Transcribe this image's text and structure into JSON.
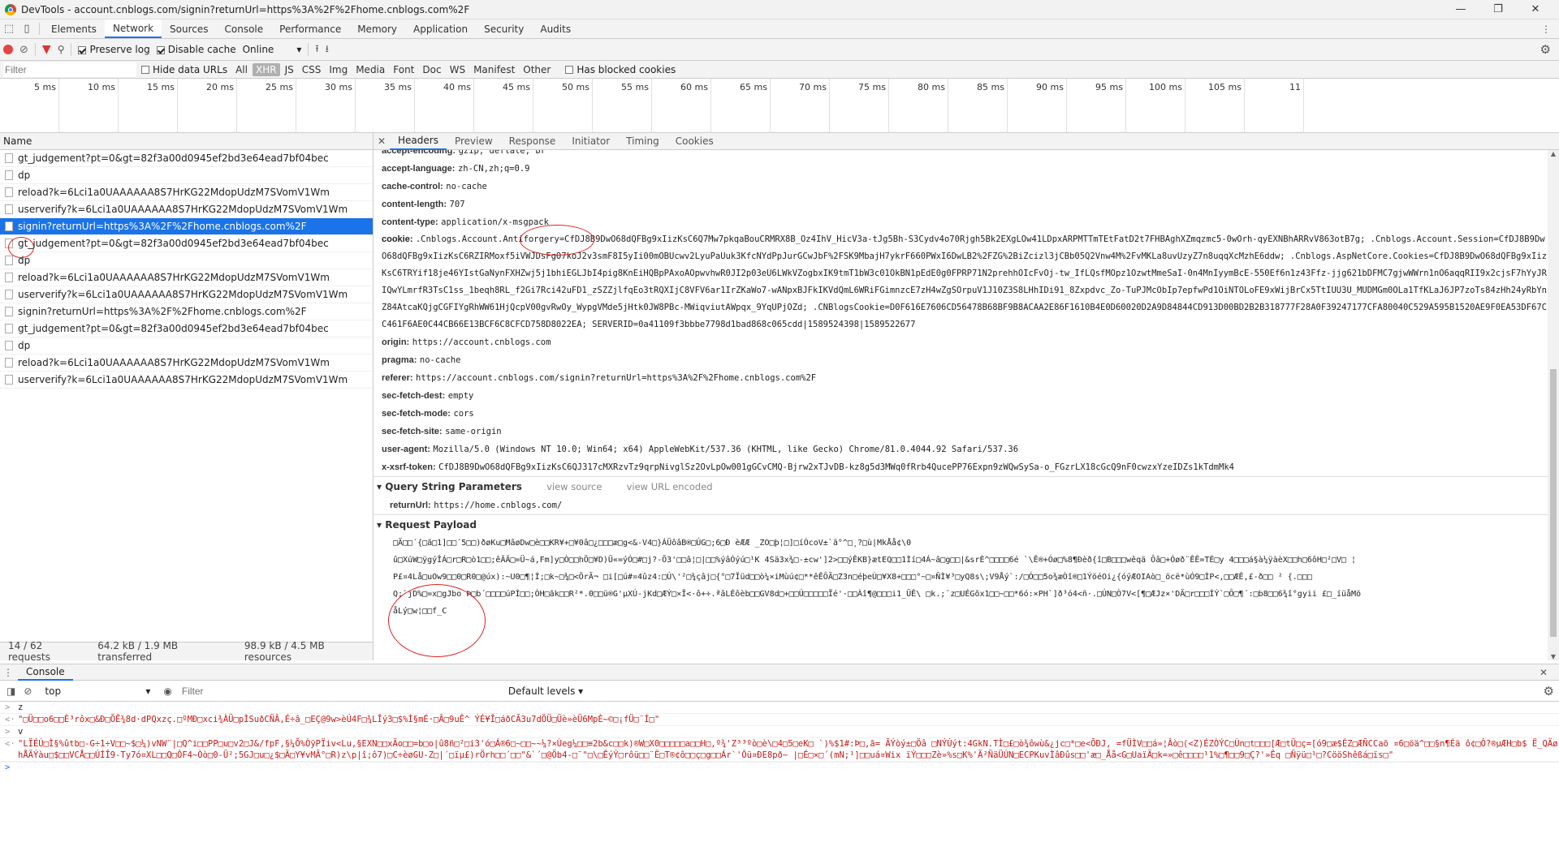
{
  "window": {
    "title": "DevTools - account.cnblogs.com/signin?returnUrl=https%3A%2F%2Fhome.cnblogs.com%2F",
    "minimize": "—",
    "restore": "❐",
    "close": "✕"
  },
  "tabs": [
    {
      "label": "Elements"
    },
    {
      "label": "Network",
      "active": true
    },
    {
      "label": "Sources"
    },
    {
      "label": "Console"
    },
    {
      "label": "Performance"
    },
    {
      "label": "Memory"
    },
    {
      "label": "Application"
    },
    {
      "label": "Security"
    },
    {
      "label": "Audits"
    }
  ],
  "toolbar": {
    "preserve_log": "Preserve log",
    "disable_cache": "Disable cache",
    "throttle": "Online"
  },
  "filter": {
    "placeholder": "Filter",
    "hide_data_urls": "Hide data URLs",
    "types": [
      "All",
      "XHR",
      "JS",
      "CSS",
      "Img",
      "Media",
      "Font",
      "Doc",
      "WS",
      "Manifest",
      "Other"
    ],
    "active_type": "XHR",
    "blocked_cookies": "Has blocked cookies"
  },
  "timeline": {
    "ticks": [
      "5 ms",
      "10 ms",
      "15 ms",
      "20 ms",
      "25 ms",
      "30 ms",
      "35 ms",
      "40 ms",
      "45 ms",
      "50 ms",
      "55 ms",
      "60 ms",
      "65 ms",
      "70 ms",
      "75 ms",
      "80 ms",
      "85 ms",
      "90 ms",
      "95 ms",
      "100 ms",
      "105 ms",
      "11"
    ]
  },
  "reqlist": {
    "header": "Name",
    "items": [
      "gt_judgement?pt=0&gt=82f3a00d0945ef2bd3e64ead7bf04bec",
      "dp",
      "reload?k=6Lci1a0UAAAAAA8S7HrKG22MdopUdzM7SVomV1Wm",
      "userverify?k=6Lci1a0UAAAAAA8S7HrKG22MdopUdzM7SVomV1Wm",
      "signin?returnUrl=https%3A%2F%2Fhome.cnblogs.com%2F",
      "gt_judgement?pt=0&gt=82f3a00d0945ef2bd3e64ead7bf04bec",
      "dp",
      "reload?k=6Lci1a0UAAAAAA8S7HrKG22MdopUdzM7SVomV1Wm",
      "userverify?k=6Lci1a0UAAAAAA8S7HrKG22MdopUdzM7SVomV1Wm",
      "signin?returnUrl=https%3A%2F%2Fhome.cnblogs.com%2F",
      "gt_judgement?pt=0&gt=82f3a00d0945ef2bd3e64ead7bf04bec",
      "dp",
      "reload?k=6Lci1a0UAAAAAA8S7HrKG22MdopUdzM7SVomV1Wm",
      "userverify?k=6Lci1a0UAAAAAA8S7HrKG22MdopUdzM7SVomV1Wm"
    ],
    "selected_index": 4,
    "status": {
      "requests": "14 / 62 requests",
      "transferred": "64.2 kB / 1.9 MB transferred",
      "resources": "98.9 kB / 4.5 MB resources"
    }
  },
  "detail": {
    "tabs": [
      "Headers",
      "Preview",
      "Response",
      "Initiator",
      "Timing",
      "Cookies"
    ],
    "active_tab": "Headers",
    "headers": [
      {
        "k": "accept-encoding:",
        "v": "gzip, deflate, br"
      },
      {
        "k": "accept-language:",
        "v": "zh-CN,zh;q=0.9"
      },
      {
        "k": "cache-control:",
        "v": "no-cache"
      },
      {
        "k": "content-length:",
        "v": "707"
      },
      {
        "k": "content-type:",
        "v": "application/x-msgpack"
      }
    ],
    "cookie_key": "cookie:",
    "cookie_val": ".Cnblogs.Account.Antiforgery=CfDJ8B9DwO68dQFBg9xIizKsC6Q7Mw7pkqaBouCRMRX8B_Oz4IhV_HicV3a-tJg5Bh-S3Cydv4o70Rjgh5Bk2EXgLOw41LDpxARPMTTmTEtFatD2t7FHBAghXZmqzmc5-0wOrh-qyEXNBhARRvV863otB7g; .Cnblogs.Account.Session=CfDJ8B9DwO68dQFBg9xIizKsC6RZIRMoxf5iVWJDsFgO7koJ2v3smF8I5yIi00mOBUcwv2LyuPaUuk3KfcNYdPpJurGCwJbF%2FSK9MbajH7ykrF660PWxI6DwLB2%2FZG%2BiZcizl3jCBb05Q2Vnw4M%2FvMKLa8uvUzyZ7n8uqqXcMzhE6ddw; .Cnblogs.AspNetCore.Cookies=CfDJ8B9DwO68dQFBg9xIizKsC6TRYif18je46YIstGaNynFXHZwj5j1bhiEGLJbI4pig8KnEiHQBpPAxoAOpwvhwR0JI2p03eU6LWkVZogbxIK9tmT1bW3c01OkBN1pEdE0g0FPRP71N2prehhOIcFvOj-tw_IfLQsfMOpz1OzwtMmeSaI-0n4MnIyymBcE-550Ef6n1z43Ffz-jjg621bDFMC7gjwWWrn1nO6aqqRII9x2cjsF7hYyJRIQwYLmrfR3TsC1ss_1beqh8RL_f2Gi7Rci42uFD1_zSZZjlfqEo3tRQXIjC8VFV6ar1IrZKaWo7-wANpxBJFkIKVdQmL6WRiFGimnzcE7zH4wZgSOrpuV1J10Z3S8LHhIDi91_8Zxpdvc_Zo-TuPJMcObIp7epfwPd1OiNTOLoFE9xWijBrCx5TtIUU3U_MUDMGm0OLa1TfKLaJ6JP7zoTs84zHh24yRbYnZ84AtcaKQjgCGFIYgRhWW61HjQcpV00gvRwOy_WypgVMde5jHtk0JW8PBc-MWiqviutAWpqx_9YqUPjOZd; .CNBlogsCookie=D0F616E7606CD56478B68BF9B8ACAA2E86F1610B4E0D60020D2A9D84844CD913D00BD2B2B318777F28A0F39247177CFA80040C529A595B1520AE9F0EA53DF67CC461F6AE0C44CB66E13BCF6C8CFCD758D8022EA; SERVERID=0a41109f3bbbe7798d1bad868c065cdd|1589524398|1589522677",
    "headers2": [
      {
        "k": "origin:",
        "v": "https://account.cnblogs.com"
      },
      {
        "k": "pragma:",
        "v": "no-cache"
      },
      {
        "k": "referer:",
        "v": "https://account.cnblogs.com/signin?returnUrl=https%3A%2F%2Fhome.cnblogs.com%2F"
      },
      {
        "k": "sec-fetch-dest:",
        "v": "empty"
      },
      {
        "k": "sec-fetch-mode:",
        "v": "cors"
      },
      {
        "k": "sec-fetch-site:",
        "v": "same-origin"
      },
      {
        "k": "user-agent:",
        "v": "Mozilla/5.0 (Windows NT 10.0; Win64; x64) AppleWebKit/537.36 (KHTML, like Gecko) Chrome/81.0.4044.92 Safari/537.36"
      },
      {
        "k": "x-xsrf-token:",
        "v": "CfDJ8B9DwO68dQFBg9xIizKsC6QJ317cMXRzvTz9qrpNivglSz2OvLpOw001gGCvCMQ-Bjrw2xTJvDB-kz8g5d3MWq0fRrb4QucePP76Expn9zWQwSySa-o_FGzrLX18cGcQ9nF0cwzxYzeIDZs1kTdmMk4"
      }
    ],
    "qsp": {
      "title": "Query String Parameters",
      "view_source": "view source",
      "view_url": "view URL encoded",
      "k": "returnUrl:",
      "v": "https://home.cnblogs.com/"
    },
    "payload": {
      "title": "Request Payload",
      "lines": [
        "□Ä□□´{□ã□1]□□´5□□)ðøKu□MâøDw□è□□KR¥+□¥0â□¿□□□æ□g<&-V4□}ÁÜôâB®□ÚG□;6□Ð èÆÆ _ZO□þ¦□]□íÓcoV±`ã°^□¸?□ù|MkÅå¢\\0",
        "û□XúW□ÿgýÎÁ□r□R□ò1□□;êÂÂ□=Ü~á,Fm]y□Ò□□hÖ□¥D)Ü«=ýÓ□#□j?-Ö3'□□â¦□|□□%ýâÓýú□¹K 4Sä3x¾□-±cw']2>□□ýÊKB}ætEQ□□1Ìí□4Á~â□g□□|&srÈ^□□□□6é `\\Ê®+Óø□%8¶Ðèð{î□B□□□wêqä  Ôâ□+Óøð¨ÊÊ=TÈ□y 4□□□á§à¼ÿàèX□□h□6ôH□²□V□  ¦",
        "P£¤4Lå□uOw9□□0□R0□@úx):~U0□¶¦Ì;□k~□¾□<ÖrÃ¬ □i[□ú#¤4ûz4:□Ú\\'²□¾çâj□{°□7Ïüd□□ò¼×iMùú¢□**êÊÔÃ□Z3n□éþeÙ□¥X8+□□□°~□¤ÑÌ¥³□yQ8s\\;V9Åý`:/□Ó□□5o¾æÒî®□1ÝöéOi¿{óýÆOIAò□_öcë*ùÓ9□ÌP<,□□ÆÊ,£-ð□□ ² {.□□□",
        "Q;`jD%□=x□gJbo Þ□b´□□□□úPÍ□□;ÒH□ãk□□R²*.0□□ü®G'µXÚ-jKd□ÆÝ□×Ï<·ô+÷.ªâLÉôèb□□GV8d□+□□Ú□□□□□Ïé'·□□Àî¶@□□□i1_ÜÊ\\ □k.;¨z□UÉGõx1□□~□□*6ó:×PH`]ð³ó4<ñ·.□ÚN□Ò7V<[¶□ÆJz×'DÄ□r□□□ÍÝ`□Ô□¶´:□b8□□6¾î°gyii £□_íüåMö",
        "åLý□w¦□□f_C"
      ]
    }
  },
  "console": {
    "tab": "Console",
    "context": "top",
    "filter_placeholder": "Filter",
    "levels": "Default levels ▾",
    "lines": [
      {
        "pfx": ">",
        "text": "z",
        "kind": "input"
      },
      {
        "pfx": "<·",
        "text": "\"□Ü□□o6□□È³rôx□&Ð□ÕÊ¾8d·dPQxzç.□ºMÐ□xci¾ÀÜ□pÌSuðCÑÂ,É÷â_□EÇ@9w>èÚ4F□¾LÎý3□$%Ì§mÉ·□Â□9uÊ^ ÝÉ¥Î□áðCÃ3u7dÖÜ□Üè»èÜ6MpÈ~©□¡fÜ□¨Í□\"",
        "kind": "string"
      },
      {
        "pfx": ">",
        "text": "v",
        "kind": "input"
      },
      {
        "pfx": "<·",
        "text": "\"LÏÉÚ□Ì§%ûtb□-G÷1÷V□□~$□¼)vNW¨|□Q^i□□PP□u□v2□J&/fpF,§¼Õ%ÒÿPÏiv<Lu,§EXN□□xÄo□□=b□o|û8ñ□²□i3'ó□Á®6□~□□~~¼?×Ùeg¼□□≡2b&c□□k)®W□X0□□□□□a□□H□,º¾'Z³³ºò□è\\□4□5□eK□ `)%$1#:Þ□,ã= ÃÝòý±□Öâ □NÝÚýt:4GkN.TÌ□£□ò¾ôwù&¿jc□*□e<ÕÐJ,  =fÜÌV□□á»¦Âò□(<Z)ÉZÒÝC□Ùn□t□□□[Æ□tÜ□ç=[ó9□æ$ÉZ□ÆÑCCaõ ¤6□öä^□□§n¶Éä ô¢□Ô?®µÆH□b$ Ë_QÄøhÅÄÝàu□$□□VCÅ□□ÚÍÎ9-Ty7ó¤XL□□Q□ÔF4~Òò□0-Ü²;5GJ□u□¿$□Ã□Y¥vMÃ°□R)z\\p|î;ô7)□C÷èøGU-Z□|´□ïµ£)rÖrh□□´□□\"&`´□@Öb4-□¨\"□\\□ÊýÝ□rôü□□¨Ë□T®¢ô□□ç□g□□Ár`'Ôü¤ÐE8pð~ |□É□×□´(mN;¹]□□uá¤Wix ïÝ□□□Zè»%s□K%'Ã²ÑäÜÚN□ECPKuvÌâÐûs□□'æ□_Åå<G□UaïÄ□k=»□ê□□□□¹1%□¶□□9□Ç?'»Êq  □Ñÿü□¹□?CööShêßá□ïs□\"",
        "kind": "string"
      },
      {
        "pfx": ">",
        "text": "",
        "kind": "prompt"
      }
    ]
  }
}
